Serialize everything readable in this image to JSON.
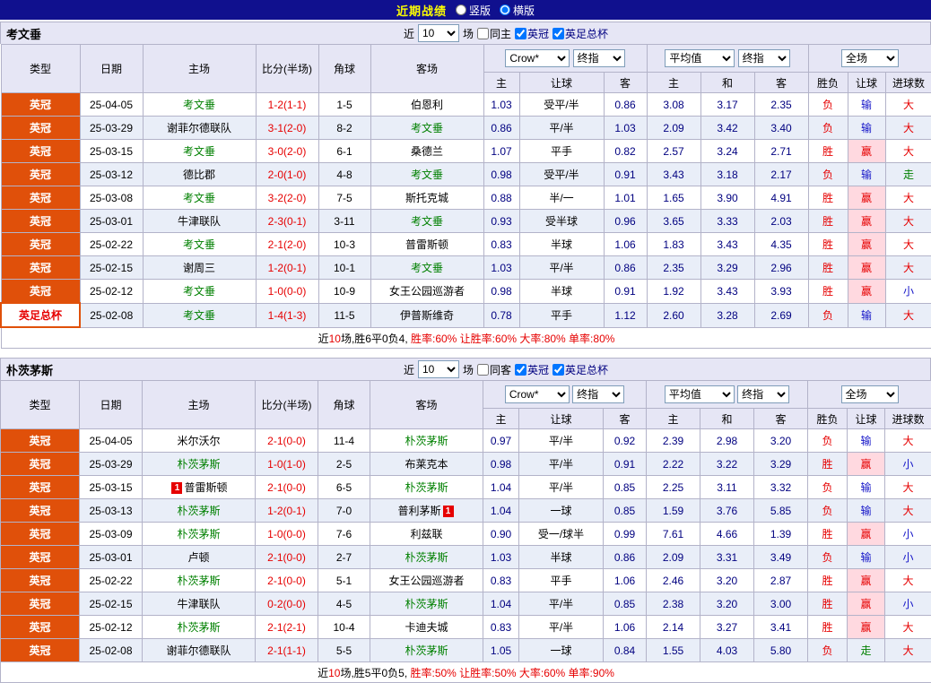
{
  "top_bar": {
    "title": "近期战绩",
    "options": [
      {
        "label": "竖版",
        "selected": false
      },
      {
        "label": "横版",
        "selected": true
      }
    ]
  },
  "colors": {
    "title_bar_bg": "#10108e",
    "title_text": "#ffff00",
    "league_cell_bg": "#e0500a",
    "focus_team_green": "#008000",
    "score_red": "#e60000",
    "odds_navy": "#000080",
    "lose_blue": "#1414c8",
    "draw_green": "#008000",
    "alt_row_bg": "#e9eef8",
    "header_bg": "#e6e6f5"
  },
  "sections": [
    {
      "team": "考文垂",
      "filters": {
        "prefix": "近",
        "count": "10",
        "suffix": "场",
        "checkboxes": [
          {
            "label": "同主",
            "checked": false
          },
          {
            "label": "英冠",
            "checked": true
          },
          {
            "label": "英足总杯",
            "checked": true
          }
        ]
      },
      "table_header": {
        "type": "类型",
        "date": "日期",
        "home": "主场",
        "score": "比分(半场)",
        "corner": "角球",
        "away": "客场",
        "odds_selects": [
          "Crow*",
          "终指"
        ],
        "avg_selects": [
          "平均值",
          "终指"
        ],
        "result_select": "全场",
        "odds_cols": [
          "主",
          "让球",
          "客"
        ],
        "avg_cols": [
          "主",
          "和",
          "客"
        ],
        "result_cols": [
          "胜负",
          "让球",
          "进球数"
        ]
      },
      "rows": [
        {
          "type": "英冠",
          "type_variant": "league",
          "date": "25-04-05",
          "home": "考文垂",
          "home_focus": true,
          "home_badge": "",
          "score": "1-2(1-1)",
          "corner": "1-5",
          "away": "伯恩利",
          "away_focus": false,
          "away_badge": "",
          "odds": [
            "1.03",
            "受平/半",
            "0.86"
          ],
          "avg": [
            "3.08",
            "3.17",
            "2.35"
          ],
          "result": [
            "负",
            "输",
            "大"
          ]
        },
        {
          "type": "英冠",
          "type_variant": "league",
          "date": "25-03-29",
          "home": "谢菲尔德联队",
          "home_focus": false,
          "home_badge": "",
          "score": "3-1(2-0)",
          "corner": "8-2",
          "away": "考文垂",
          "away_focus": true,
          "away_badge": "",
          "odds": [
            "0.86",
            "平/半",
            "1.03"
          ],
          "avg": [
            "2.09",
            "3.42",
            "3.40"
          ],
          "result": [
            "负",
            "输",
            "大"
          ]
        },
        {
          "type": "英冠",
          "type_variant": "league",
          "date": "25-03-15",
          "home": "考文垂",
          "home_focus": true,
          "home_badge": "",
          "score": "3-0(2-0)",
          "corner": "6-1",
          "away": "桑德兰",
          "away_focus": false,
          "away_badge": "",
          "odds": [
            "1.07",
            "平手",
            "0.82"
          ],
          "avg": [
            "2.57",
            "3.24",
            "2.71"
          ],
          "result": [
            "胜",
            "赢",
            "大"
          ]
        },
        {
          "type": "英冠",
          "type_variant": "league",
          "date": "25-03-12",
          "home": "德比郡",
          "home_focus": false,
          "home_badge": "",
          "score": "2-0(1-0)",
          "corner": "4-8",
          "away": "考文垂",
          "away_focus": true,
          "away_badge": "",
          "odds": [
            "0.98",
            "受平/半",
            "0.91"
          ],
          "avg": [
            "3.43",
            "3.18",
            "2.17"
          ],
          "result": [
            "负",
            "输",
            "走"
          ]
        },
        {
          "type": "英冠",
          "type_variant": "league",
          "date": "25-03-08",
          "home": "考文垂",
          "home_focus": true,
          "home_badge": "",
          "score": "3-2(2-0)",
          "corner": "7-5",
          "away": "斯托克城",
          "away_focus": false,
          "away_badge": "",
          "odds": [
            "0.88",
            "半/一",
            "1.01"
          ],
          "avg": [
            "1.65",
            "3.90",
            "4.91"
          ],
          "result": [
            "胜",
            "赢",
            "大"
          ]
        },
        {
          "type": "英冠",
          "type_variant": "league",
          "date": "25-03-01",
          "home": "牛津联队",
          "home_focus": false,
          "home_badge": "",
          "score": "2-3(0-1)",
          "corner": "3-11",
          "away": "考文垂",
          "away_focus": true,
          "away_badge": "",
          "odds": [
            "0.93",
            "受半球",
            "0.96"
          ],
          "avg": [
            "3.65",
            "3.33",
            "2.03"
          ],
          "result": [
            "胜",
            "赢",
            "大"
          ]
        },
        {
          "type": "英冠",
          "type_variant": "league",
          "date": "25-02-22",
          "home": "考文垂",
          "home_focus": true,
          "home_badge": "",
          "score": "2-1(2-0)",
          "corner": "10-3",
          "away": "普雷斯顿",
          "away_focus": false,
          "away_badge": "",
          "odds": [
            "0.83",
            "半球",
            "1.06"
          ],
          "avg": [
            "1.83",
            "3.43",
            "4.35"
          ],
          "result": [
            "胜",
            "赢",
            "大"
          ]
        },
        {
          "type": "英冠",
          "type_variant": "league",
          "date": "25-02-15",
          "home": "谢周三",
          "home_focus": false,
          "home_badge": "",
          "score": "1-2(0-1)",
          "corner": "10-1",
          "away": "考文垂",
          "away_focus": true,
          "away_badge": "",
          "odds": [
            "1.03",
            "平/半",
            "0.86"
          ],
          "avg": [
            "2.35",
            "3.29",
            "2.96"
          ],
          "result": [
            "胜",
            "赢",
            "大"
          ]
        },
        {
          "type": "英冠",
          "type_variant": "league",
          "date": "25-02-12",
          "home": "考文垂",
          "home_focus": true,
          "home_badge": "",
          "score": "1-0(0-0)",
          "corner": "10-9",
          "away": "女王公园巡游者",
          "away_focus": false,
          "away_badge": "",
          "odds": [
            "0.98",
            "半球",
            "0.91"
          ],
          "avg": [
            "1.92",
            "3.43",
            "3.93"
          ],
          "result": [
            "胜",
            "赢",
            "小"
          ]
        },
        {
          "type": "英足总杯",
          "type_variant": "cup",
          "date": "25-02-08",
          "home": "考文垂",
          "home_focus": true,
          "home_badge": "",
          "score": "1-4(1-3)",
          "corner": "11-5",
          "away": "伊普斯维奇",
          "away_focus": false,
          "away_badge": "",
          "odds": [
            "0.78",
            "平手",
            "1.12"
          ],
          "avg": [
            "2.60",
            "3.28",
            "2.69"
          ],
          "result": [
            "负",
            "输",
            "大"
          ]
        }
      ],
      "footer": [
        {
          "text": "近",
          "color": "dark"
        },
        {
          "text": "10",
          "color": "red"
        },
        {
          "text": "场,胜6平0负4, ",
          "color": "dark"
        },
        {
          "text": "胜率:60% 让胜率:60% 大率:80% 单率:80%",
          "color": "red"
        }
      ]
    },
    {
      "team": "朴茨茅斯",
      "filters": {
        "prefix": "近",
        "count": "10",
        "suffix": "场",
        "checkboxes": [
          {
            "label": "同客",
            "checked": false
          },
          {
            "label": "英冠",
            "checked": true
          },
          {
            "label": "英足总杯",
            "checked": true
          }
        ]
      },
      "table_header": {
        "type": "类型",
        "date": "日期",
        "home": "主场",
        "score": "比分(半场)",
        "corner": "角球",
        "away": "客场",
        "odds_selects": [
          "Crow*",
          "终指"
        ],
        "avg_selects": [
          "平均值",
          "终指"
        ],
        "result_select": "全场",
        "odds_cols": [
          "主",
          "让球",
          "客"
        ],
        "avg_cols": [
          "主",
          "和",
          "客"
        ],
        "result_cols": [
          "胜负",
          "让球",
          "进球数"
        ]
      },
      "rows": [
        {
          "type": "英冠",
          "type_variant": "league",
          "date": "25-04-05",
          "home": "米尔沃尔",
          "home_focus": false,
          "home_badge": "",
          "score": "2-1(0-0)",
          "corner": "11-4",
          "away": "朴茨茅斯",
          "away_focus": true,
          "away_badge": "",
          "odds": [
            "0.97",
            "平/半",
            "0.92"
          ],
          "avg": [
            "2.39",
            "2.98",
            "3.20"
          ],
          "result": [
            "负",
            "输",
            "大"
          ]
        },
        {
          "type": "英冠",
          "type_variant": "league",
          "date": "25-03-29",
          "home": "朴茨茅斯",
          "home_focus": true,
          "home_badge": "",
          "score": "1-0(1-0)",
          "corner": "2-5",
          "away": "布莱克本",
          "away_focus": false,
          "away_badge": "",
          "odds": [
            "0.98",
            "平/半",
            "0.91"
          ],
          "avg": [
            "2.22",
            "3.22",
            "3.29"
          ],
          "result": [
            "胜",
            "赢",
            "小"
          ]
        },
        {
          "type": "英冠",
          "type_variant": "league",
          "date": "25-03-15",
          "home": "普雷斯顿",
          "home_focus": false,
          "home_badge": "1",
          "score": "2-1(0-0)",
          "corner": "6-5",
          "away": "朴茨茅斯",
          "away_focus": true,
          "away_badge": "",
          "odds": [
            "1.04",
            "平/半",
            "0.85"
          ],
          "avg": [
            "2.25",
            "3.11",
            "3.32"
          ],
          "result": [
            "负",
            "输",
            "大"
          ]
        },
        {
          "type": "英冠",
          "type_variant": "league",
          "date": "25-03-13",
          "home": "朴茨茅斯",
          "home_focus": true,
          "home_badge": "",
          "score": "1-2(0-1)",
          "corner": "7-0",
          "away": "普利茅斯",
          "away_focus": false,
          "away_badge": "1",
          "odds": [
            "1.04",
            "一球",
            "0.85"
          ],
          "avg": [
            "1.59",
            "3.76",
            "5.85"
          ],
          "result": [
            "负",
            "输",
            "大"
          ]
        },
        {
          "type": "英冠",
          "type_variant": "league",
          "date": "25-03-09",
          "home": "朴茨茅斯",
          "home_focus": true,
          "home_badge": "",
          "score": "1-0(0-0)",
          "corner": "7-6",
          "away": "利兹联",
          "away_focus": false,
          "away_badge": "",
          "odds": [
            "0.90",
            "受一/球半",
            "0.99"
          ],
          "avg": [
            "7.61",
            "4.66",
            "1.39"
          ],
          "result": [
            "胜",
            "赢",
            "小"
          ]
        },
        {
          "type": "英冠",
          "type_variant": "league",
          "date": "25-03-01",
          "home": "卢顿",
          "home_focus": false,
          "home_badge": "",
          "score": "2-1(0-0)",
          "corner": "2-7",
          "away": "朴茨茅斯",
          "away_focus": true,
          "away_badge": "",
          "odds": [
            "1.03",
            "半球",
            "0.86"
          ],
          "avg": [
            "2.09",
            "3.31",
            "3.49"
          ],
          "result": [
            "负",
            "输",
            "小"
          ]
        },
        {
          "type": "英冠",
          "type_variant": "league",
          "date": "25-02-22",
          "home": "朴茨茅斯",
          "home_focus": true,
          "home_badge": "",
          "score": "2-1(0-0)",
          "corner": "5-1",
          "away": "女王公园巡游者",
          "away_focus": false,
          "away_badge": "",
          "odds": [
            "0.83",
            "平手",
            "1.06"
          ],
          "avg": [
            "2.46",
            "3.20",
            "2.87"
          ],
          "result": [
            "胜",
            "赢",
            "大"
          ]
        },
        {
          "type": "英冠",
          "type_variant": "league",
          "date": "25-02-15",
          "home": "牛津联队",
          "home_focus": false,
          "home_badge": "",
          "score": "0-2(0-0)",
          "corner": "4-5",
          "away": "朴茨茅斯",
          "away_focus": true,
          "away_badge": "",
          "odds": [
            "1.04",
            "平/半",
            "0.85"
          ],
          "avg": [
            "2.38",
            "3.20",
            "3.00"
          ],
          "result": [
            "胜",
            "赢",
            "小"
          ]
        },
        {
          "type": "英冠",
          "type_variant": "league",
          "date": "25-02-12",
          "home": "朴茨茅斯",
          "home_focus": true,
          "home_badge": "",
          "score": "2-1(2-1)",
          "corner": "10-4",
          "away": "卡迪夫城",
          "away_focus": false,
          "away_badge": "",
          "odds": [
            "0.83",
            "平/半",
            "1.06"
          ],
          "avg": [
            "2.14",
            "3.27",
            "3.41"
          ],
          "result": [
            "胜",
            "赢",
            "大"
          ]
        },
        {
          "type": "英冠",
          "type_variant": "league",
          "date": "25-02-08",
          "home": "谢菲尔德联队",
          "home_focus": false,
          "home_badge": "",
          "score": "2-1(1-1)",
          "corner": "5-5",
          "away": "朴茨茅斯",
          "away_focus": true,
          "away_badge": "",
          "odds": [
            "1.05",
            "一球",
            "0.84"
          ],
          "avg": [
            "1.55",
            "4.03",
            "5.80"
          ],
          "result": [
            "负",
            "走",
            "大"
          ]
        }
      ],
      "footer": [
        {
          "text": "近",
          "color": "dark"
        },
        {
          "text": "10",
          "color": "red"
        },
        {
          "text": "场,胜5平0负5, ",
          "color": "dark"
        },
        {
          "text": "胜率:50% 让胜率:50% 大率:60% 单率:90%",
          "color": "red"
        }
      ]
    }
  ]
}
